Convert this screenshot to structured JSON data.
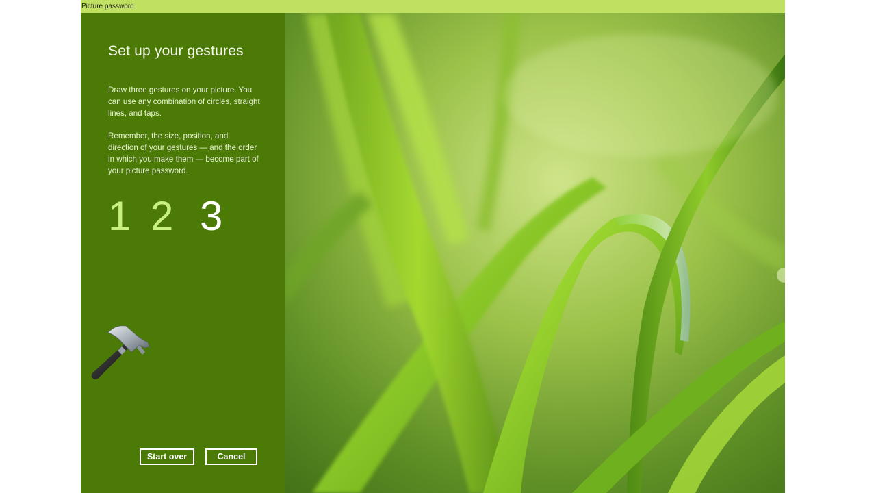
{
  "window": {
    "title": "Picture password"
  },
  "panel": {
    "heading": "Set up your gestures",
    "paragraph1": "Draw three gestures on your picture. You can use any combination of circles, straight lines, and taps.",
    "paragraph2": "Remember, the size, position, and direction of your gestures — and the order in which you make them — become part of your picture password.",
    "steps": [
      "1",
      "2",
      "3"
    ],
    "current_step": 3,
    "tool_icon": "hammer-icon"
  },
  "buttons": {
    "start_over": "Start over",
    "cancel": "Cancel"
  },
  "picture": {
    "subject": "green-grass-blades",
    "cursor_icon": "arrow-cursor-icon"
  },
  "colors": {
    "titlebar": "#bfe060",
    "panel": "#4b7a07",
    "step_done": "#c8f080",
    "step_current": "#ffffff"
  }
}
